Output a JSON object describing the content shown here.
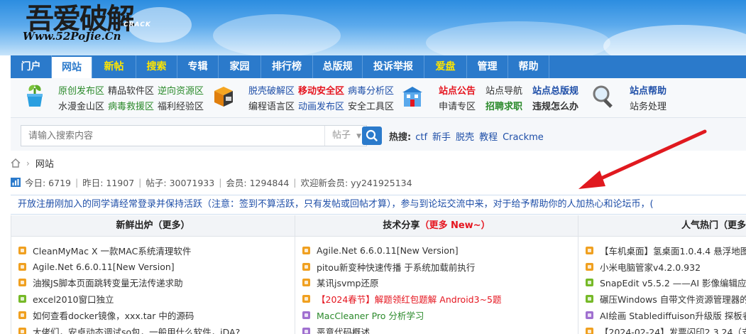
{
  "logo": {
    "cn": "吾爱破解",
    "url": "Www.52PoJie.Cn",
    "crack": "CRACK"
  },
  "nav": [
    {
      "label": "门户",
      "color": "white"
    },
    {
      "label": "网站",
      "active": true
    },
    {
      "label": "新帖",
      "color": "yellow"
    },
    {
      "label": "搜索",
      "color": "yellow"
    },
    {
      "label": "专辑"
    },
    {
      "label": "家园"
    },
    {
      "label": "排行榜"
    },
    {
      "label": "总版规"
    },
    {
      "label": "投诉举报"
    },
    {
      "label": "爱盘",
      "color": "yellow"
    },
    {
      "label": "管理"
    },
    {
      "label": "帮助"
    }
  ],
  "subnav": {
    "group1": {
      "row1": [
        "原创发布区",
        "精品软件区",
        "逆向资源区"
      ],
      "row2": [
        "水漫金山区",
        "病毒救援区",
        "福利经验区"
      ]
    },
    "group2": {
      "row1": [
        "脱壳破解区",
        "移动安全区",
        "病毒分析区"
      ],
      "row2": [
        "编程语言区",
        "动画发布区",
        "安全工具区"
      ]
    },
    "group3": {
      "row1": [
        "站点公告",
        "站点导航",
        "站点总版规"
      ],
      "row2": [
        "申请专区",
        "招聘求职",
        "违规怎么办"
      ]
    },
    "group4": {
      "row1": [
        "站点帮助"
      ],
      "row2": [
        "站务处理"
      ]
    }
  },
  "search": {
    "placeholder": "请输入搜索内容",
    "scope": "帖子",
    "hot_label": "热搜:",
    "hot": [
      "ctf",
      "新手",
      "脱壳",
      "教程",
      "Crackme"
    ]
  },
  "breadcrumb": {
    "current": "网站"
  },
  "stats": {
    "today": "今日: 6719",
    "yesterday": "昨日: 11907",
    "posts": "帖子: 30071933",
    "members": "会员: 1294844",
    "welcome": "欢迎新会员: yy241925134"
  },
  "notice": "开放注册刚加入的同学请经常登录并保持活跃（注意：签到不算活跃，只有发帖或回帖才算），参与到论坛交流中来，对于给予帮助你的人加热心和论坛币，(",
  "columns": [
    {
      "title": "新鲜出炉",
      "more": "（更多）",
      "rows": [
        {
          "text": "CleanMyMac X 一款MAC系统清理软件",
          "bullet": "orange"
        },
        {
          "text": "Agile.Net 6.6.0.11[New Version]",
          "bullet": "orange"
        },
        {
          "text": "油猴JS脚本页面跳转变量无法传递求助",
          "bullet": "orange"
        },
        {
          "text": "excel2010窗口独立",
          "bullet": "green"
        },
        {
          "text": "如何查看docker镜像，xxx.tar 中的源码",
          "bullet": "orange"
        },
        {
          "text": "大佬们，安卓动态调试so包，一般用什么软件，iDA?",
          "bullet": "orange"
        }
      ]
    },
    {
      "title": "技术分享",
      "more": "（更多 New~）",
      "rows": [
        {
          "text": "Agile.Net 6.6.0.11[New Version]",
          "bullet": "orange"
        },
        {
          "text": "pitou新变种快速传播 于系统加载前执行",
          "bullet": "orange"
        },
        {
          "text": "某讯jsvmp还原",
          "bullet": "orange"
        },
        {
          "text": "【2024春节】解题领红包题解 Android3~5题",
          "bullet": "orange",
          "color": "red"
        },
        {
          "text": "MacCleaner Pro 分析学习",
          "bullet": "purple",
          "color": "green"
        },
        {
          "text": "恶意代码概述",
          "bullet": "purple"
        }
      ]
    },
    {
      "title": "人气热门",
      "more": "（更多）",
      "rows": [
        {
          "text": "【车机桌面】氢桌面1.0.4.4 悬浮地图",
          "bullet": "orange"
        },
        {
          "text": "小米电脑管家v4.2.0.932",
          "bullet": "orange"
        },
        {
          "text": "SnapEdit v5.5.2 ——AI 影像编辑应用",
          "bullet": "green"
        },
        {
          "text": "碾压Windows 自带文件资源管理器的",
          "bullet": "green"
        },
        {
          "text": "AI绘画 Stablediffuison升级版 探板者",
          "bullet": "purple"
        },
        {
          "text": "【2024-02-24】发票闪印2.3.24（支持",
          "bullet": "orange"
        }
      ]
    }
  ],
  "colors": {
    "nav_bg": "#2b7acb",
    "link_blue": "#1f4fa8",
    "link_green": "#2b8a2b",
    "link_red": "#e5151f",
    "annotation_arrow": "#e0191f"
  }
}
